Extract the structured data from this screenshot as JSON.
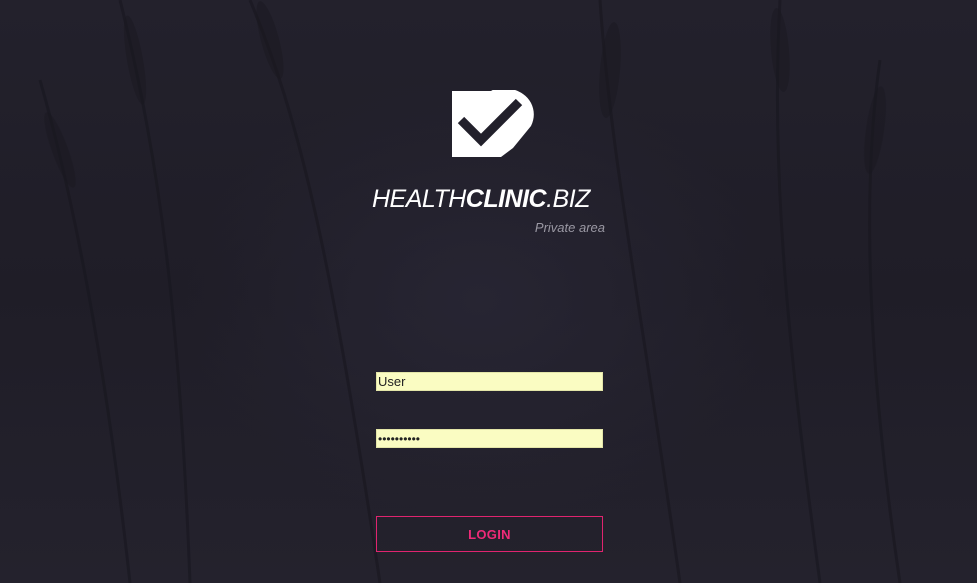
{
  "brand": {
    "name_light": "HEALTH",
    "name_bold": "CLINIC",
    "name_suffix": ".BIZ",
    "subtitle": "Private area",
    "logo_icon": "heart-check-icon"
  },
  "form": {
    "user_value": "User",
    "password_value": "••••••••••",
    "login_label": "LOGIN"
  },
  "colors": {
    "background": "#22202b",
    "accent": "#e0246f",
    "input_fill": "#fafcc2",
    "brand_text": "#ffffff",
    "subtitle_text": "#9a98a3"
  }
}
